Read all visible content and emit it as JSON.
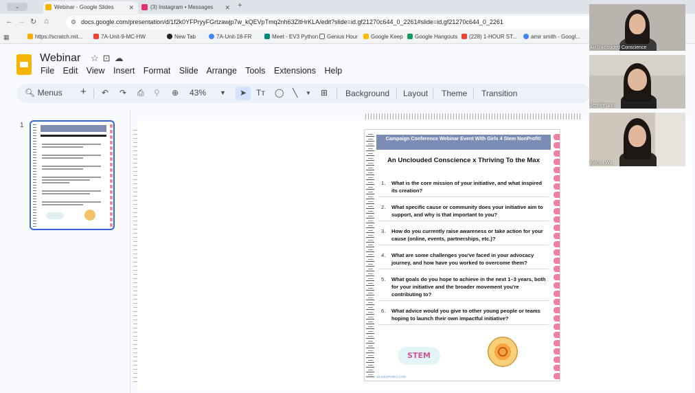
{
  "browser": {
    "tabs": [
      {
        "title": "Webinar - Google Slides",
        "color": "#f4b400"
      },
      {
        "title": "(3) Instagram • Messages",
        "color": "#e1306c"
      }
    ],
    "url": "docs.google.com/presentation/d/1f2k0YFPryyFGrtzawjp7w_kQEVpTmq2nh63ZltHrKLA/edit?slide=id.gf21270c644_0_2261#slide=id.gf21270c644_0_2261",
    "bookmarks": [
      "https://scratch.mit...",
      "7A-Unit-9-MC-HW",
      "New Tab",
      "7A-Unit-18-FR",
      "Meet - EV3 Python",
      "Genius Hour",
      "Google Keep",
      "Google Hangouts",
      "(228) 1-HOUR ST...",
      "amir smith - Googl..."
    ]
  },
  "slides": {
    "title": "Webinar",
    "menu": [
      "File",
      "Edit",
      "View",
      "Insert",
      "Format",
      "Slide",
      "Arrange",
      "Tools",
      "Extensions",
      "Help"
    ],
    "toolbar": {
      "search_label": "Menus",
      "zoom": "43%",
      "background": "Background",
      "layout": "Layout",
      "theme": "Theme",
      "transition": "Transition"
    },
    "slide_number": "1"
  },
  "slide": {
    "banner": "Campaign Conference Webinar Event With Girls 4 Stem NonProfit!",
    "title": "An Unclouded Conscience x Thriving To the Max",
    "questions": [
      {
        "n": "1.",
        "text": "What is the core mission of your initiative, and what inspired its creation?"
      },
      {
        "n": "2.",
        "text": "What specific cause or community does your initiative aim to support, and why is that important to you?"
      },
      {
        "n": "3.",
        "text": "How do you currently raise awareness or take action for your cause (online, events, partnerships, etc.)?"
      },
      {
        "n": "4.",
        "text": "What are some challenges you've faced in your advocacy journey, and how have you worked to overcome them?"
      },
      {
        "n": "5.",
        "text": "What goals do you hope to achieve in the next 1–3 years, both for your initiative and the broader movement you're contributing to?"
      },
      {
        "n": "6.",
        "text": "What advice would you give to other young people or teams hoping to launch their own impactful initiative?"
      }
    ],
    "stem_logo": "STEM",
    "footer": "ELISEOPINRA.COM"
  },
  "participants": [
    {
      "name": "An Unclouded Conscience"
    },
    {
      "name": "Jennifer Lin"
    },
    {
      "name": "Emma Wu"
    }
  ]
}
